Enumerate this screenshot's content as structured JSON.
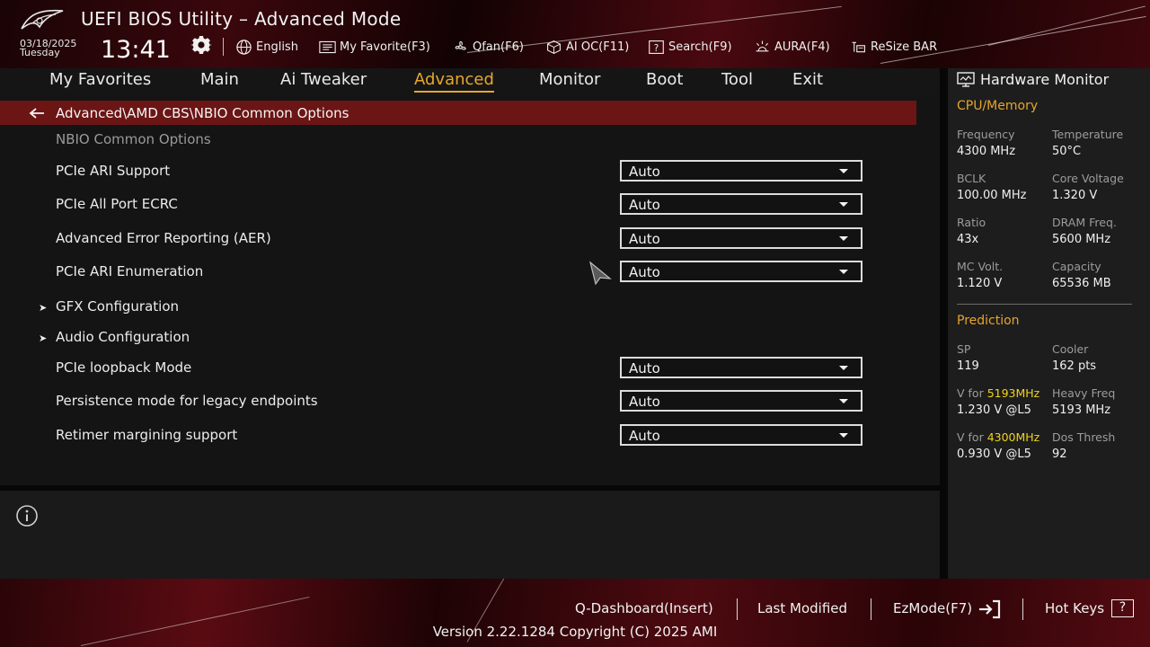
{
  "app": {
    "title": "UEFI BIOS Utility – Advanced Mode"
  },
  "status": {
    "date": "03/18/2025",
    "day": "Tuesday",
    "time": "13:41"
  },
  "toolbar": [
    {
      "icon": "globe-icon",
      "label": "English"
    },
    {
      "icon": "favorite-list-icon",
      "label": "My Favorite(F3)"
    },
    {
      "icon": "fan-icon",
      "label": "Qfan(F6)"
    },
    {
      "icon": "ai-chip-icon",
      "label": "AI OC(F11)"
    },
    {
      "icon": "search-help-icon",
      "label": "Search(F9)"
    },
    {
      "icon": "aura-light-icon",
      "label": "AURA(F4)"
    },
    {
      "icon": "resize-bar-icon",
      "label": "ReSize BAR"
    }
  ],
  "tabs": [
    {
      "label": "My Favorites",
      "active": false
    },
    {
      "label": "Main",
      "active": false
    },
    {
      "label": "Ai Tweaker",
      "active": false
    },
    {
      "label": "Advanced",
      "active": true
    },
    {
      "label": "Monitor",
      "active": false
    },
    {
      "label": "Boot",
      "active": false
    },
    {
      "label": "Tool",
      "active": false
    },
    {
      "label": "Exit",
      "active": false
    }
  ],
  "breadcrumb": "Advanced\\AMD CBS\\NBIO Common Options",
  "section_title": "NBIO Common Options",
  "settings": [
    {
      "label": "PCIe ARI Support",
      "type": "dropdown",
      "value": "Auto"
    },
    {
      "label": "PCIe All Port ECRC",
      "type": "dropdown",
      "value": "Auto"
    },
    {
      "label": "Advanced Error Reporting (AER)",
      "type": "dropdown",
      "value": "Auto"
    },
    {
      "label": "PCIe ARI Enumeration",
      "type": "dropdown",
      "value": "Auto"
    },
    {
      "label": "GFX Configuration",
      "type": "submenu"
    },
    {
      "label": "Audio Configuration",
      "type": "submenu"
    },
    {
      "label": "PCIe loopback Mode",
      "type": "dropdown",
      "value": "Auto"
    },
    {
      "label": "Persistence mode for legacy endpoints",
      "type": "dropdown",
      "value": "Auto"
    },
    {
      "label": "Retimer margining support",
      "type": "dropdown",
      "value": "Auto"
    }
  ],
  "hardware_monitor": {
    "title": "Hardware Monitor",
    "cpu_memory": {
      "title": "CPU/Memory",
      "items": [
        {
          "label": "Frequency",
          "value": "4300 MHz"
        },
        {
          "label": "Temperature",
          "value": "50°C"
        },
        {
          "label": "BCLK",
          "value": "100.00 MHz"
        },
        {
          "label": "Core Voltage",
          "value": "1.320 V"
        },
        {
          "label": "Ratio",
          "value": "43x"
        },
        {
          "label": "DRAM Freq.",
          "value": "5600 MHz"
        },
        {
          "label": "MC Volt.",
          "value": "1.120 V"
        },
        {
          "label": "Capacity",
          "value": "65536 MB"
        }
      ]
    },
    "prediction": {
      "title": "Prediction",
      "sp_label": "SP",
      "sp_value": "119",
      "cooler_label": "Cooler",
      "cooler_value": "162 pts",
      "v1_prefix": "V for ",
      "v1_freq": "5193MHz",
      "v1_value": "1.230 V @L5",
      "heavy_label": "Heavy Freq",
      "heavy_value": "5193 MHz",
      "v2_prefix": "V for ",
      "v2_freq": "4300MHz",
      "v2_value": "0.930 V @L5",
      "dos_label": "Dos Thresh",
      "dos_value": "92",
      "highlight_color": "#f2d21d"
    }
  },
  "footer": {
    "qdashboard": "Q-Dashboard(Insert)",
    "last_modified": "Last Modified",
    "ezmode": "EzMode(F7)",
    "hotkeys": "Hot Keys",
    "hotkeys_key": "?",
    "version": "Version 2.22.1284 Copyright (C) 2025 AMI"
  },
  "colors": {
    "accent": "#e8a72c",
    "breadcrumb_bg": "#6b1515"
  }
}
